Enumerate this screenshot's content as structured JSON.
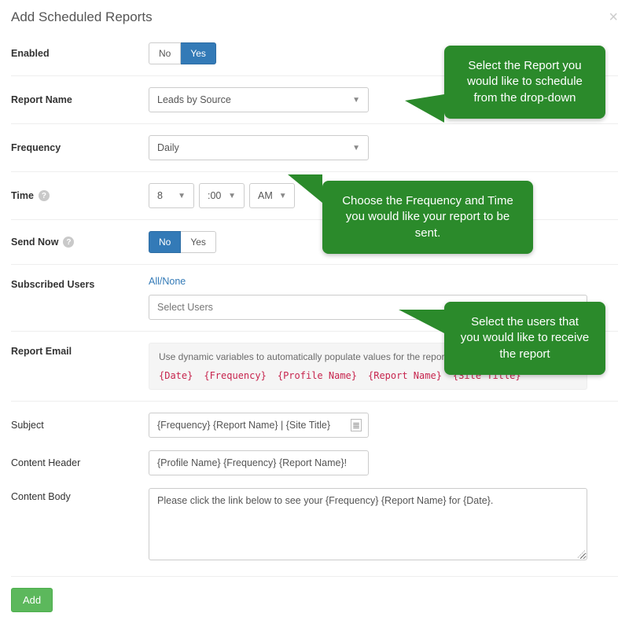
{
  "modal": {
    "title": "Add Scheduled Reports",
    "close_label": "×"
  },
  "enabled": {
    "label": "Enabled",
    "no": "No",
    "yes": "Yes",
    "active": "yes"
  },
  "report_name": {
    "label": "Report Name",
    "value": "Leads by Source"
  },
  "frequency": {
    "label": "Frequency",
    "value": "Daily"
  },
  "time": {
    "label": "Time",
    "hour": "8",
    "minute": ":00",
    "ampm": "AM"
  },
  "send_now": {
    "label": "Send Now",
    "no": "No",
    "yes": "Yes",
    "active": "no"
  },
  "subscribed": {
    "label": "Subscribed Users",
    "all_none": "All/None",
    "select_value": "Select Users"
  },
  "report_email": {
    "label": "Report Email",
    "hint": "Use dynamic variables to automatically populate values for the report email.",
    "vars": [
      "{Date}",
      "{Frequency}",
      "{Profile Name}",
      "{Report Name}",
      "{Site Title}"
    ]
  },
  "subject": {
    "label": "Subject",
    "value": "{Frequency} {Report Name} | {Site Title}"
  },
  "content_header": {
    "label": "Content Header",
    "value": "{Profile Name} {Frequency} {Report Name}!"
  },
  "content_body": {
    "label": "Content Body",
    "value": "Please click the link below to see your {Frequency} {Report Name} for {Date}."
  },
  "footer": {
    "add": "Add"
  },
  "callouts": {
    "c1": "Select the Report you would like to schedule from the drop-down",
    "c2": "Choose the Frequency and Time you would like your report to be sent.",
    "c3": "Select the users that you would like to receive the report"
  }
}
